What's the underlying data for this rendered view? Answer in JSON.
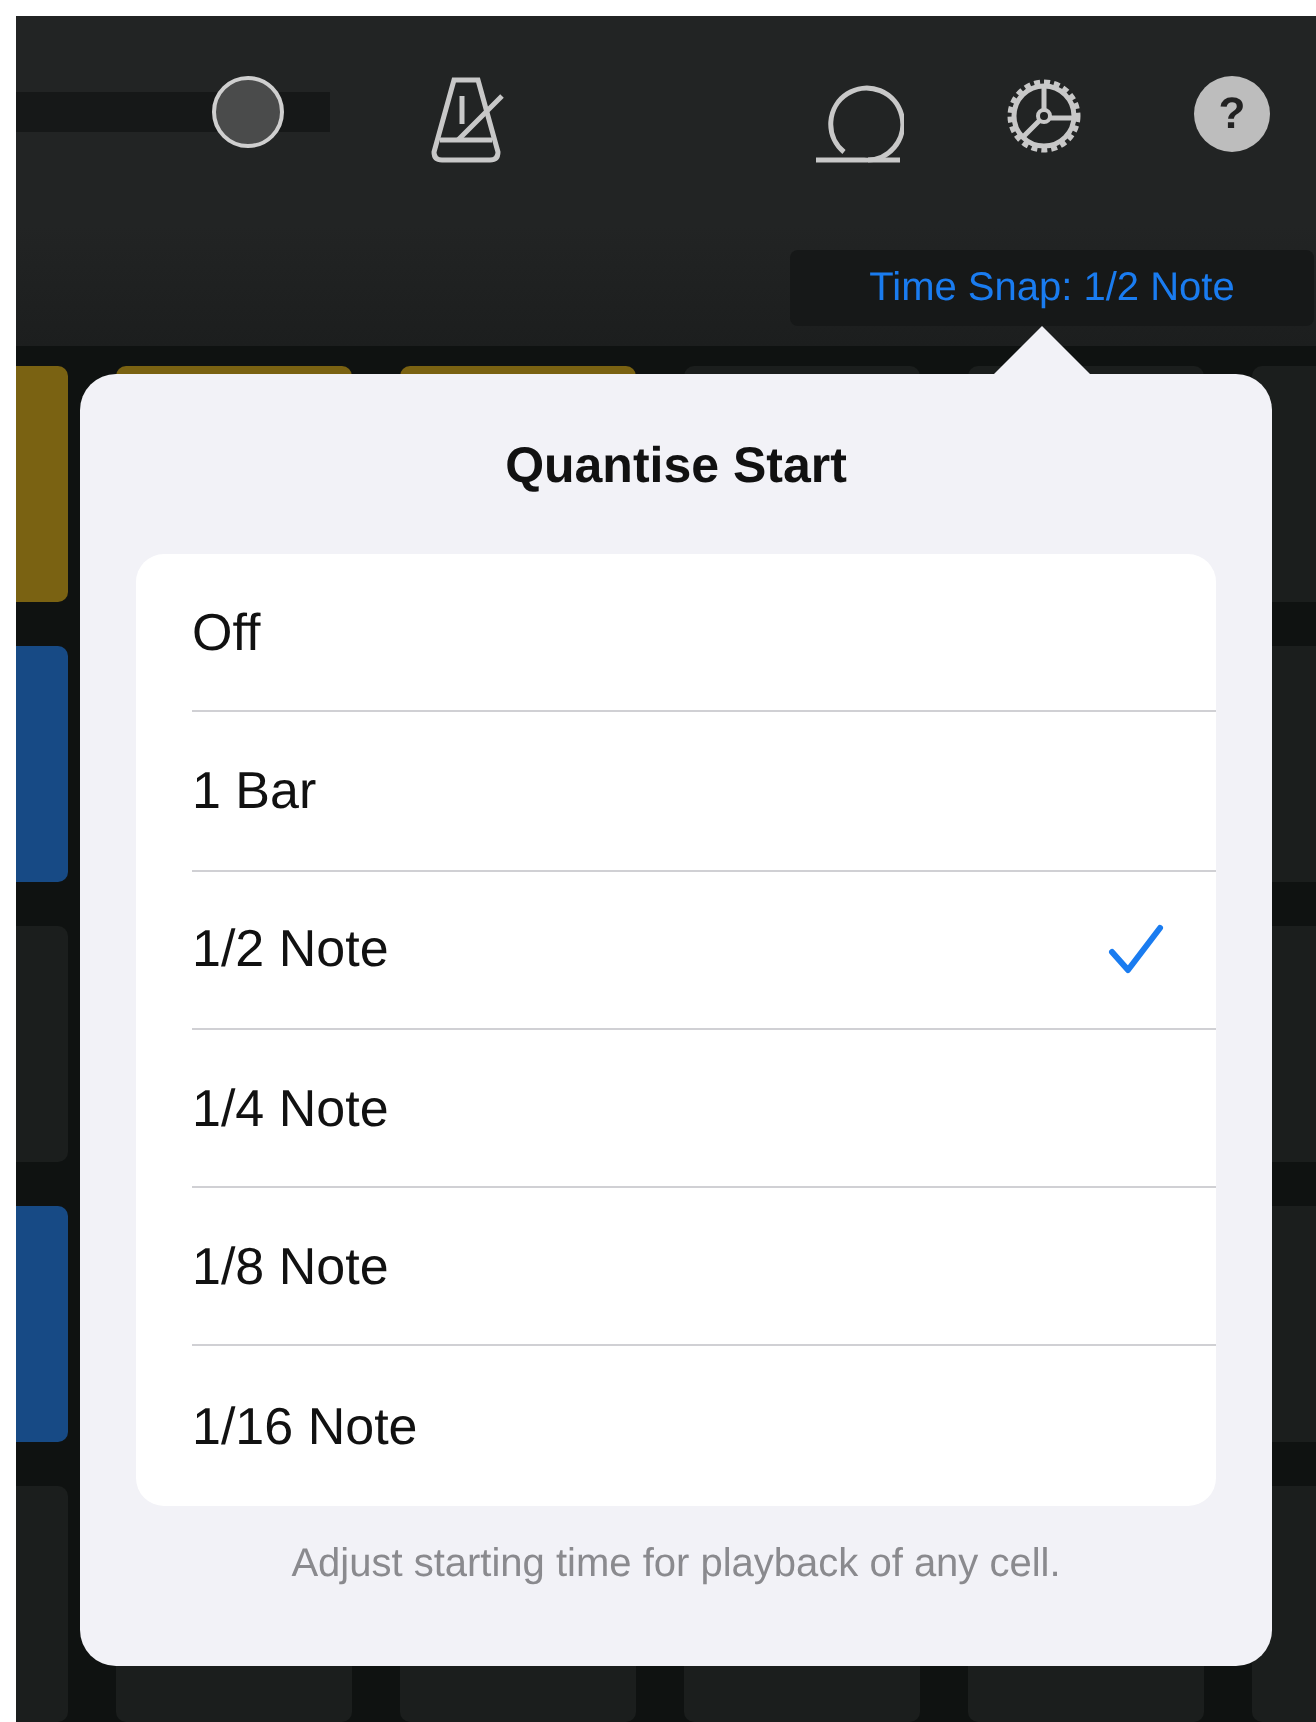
{
  "toolbar": {
    "slider": {
      "level": 0.74
    },
    "buttons": [
      {
        "kind": "metronome"
      },
      {
        "kind": "loop"
      },
      {
        "kind": "settings"
      },
      {
        "kind": "help",
        "label": "?"
      }
    ]
  },
  "time_snap": {
    "label": "Time Snap: 1/2 Note"
  },
  "pads": [
    {
      "cells": [
        {
          "color": "#7a6212"
        },
        {
          "color": "#7a6212"
        },
        {
          "color": "#7a6212"
        },
        {
          "color": "#1b1e1d"
        },
        {
          "color": "#1b1e1d"
        },
        {
          "color": "#1b1e1d"
        }
      ]
    },
    {
      "cells": [
        {
          "color": "#174a85"
        },
        {
          "color": "#1b1e1d"
        }
      ]
    },
    {
      "cells": [
        {
          "color": "#1b1e1d"
        },
        {
          "color": "#1b1e1d"
        }
      ]
    },
    {
      "cells": [
        {
          "color": "#174a85"
        },
        {
          "color": "#1b1e1d"
        }
      ]
    },
    {
      "cells": [
        {
          "color": "#1b1e1d"
        },
        {
          "color": "#1b1e1d"
        },
        {
          "color": "#1b1e1d"
        },
        {
          "color": "#1b1e1d"
        },
        {
          "color": "#1b1e1d"
        },
        {
          "color": "#1b1e1d"
        }
      ]
    }
  ],
  "popover": {
    "title": "Quantise Start",
    "options": [
      {
        "label": "Off",
        "selected": false
      },
      {
        "label": "1 Bar",
        "selected": false
      },
      {
        "label": "1/2 Note",
        "selected": true
      },
      {
        "label": "1/4 Note",
        "selected": false
      },
      {
        "label": "1/8 Note",
        "selected": false
      },
      {
        "label": "1/16 Note",
        "selected": false
      }
    ],
    "footer": "Adjust starting time for playback of any cell."
  }
}
